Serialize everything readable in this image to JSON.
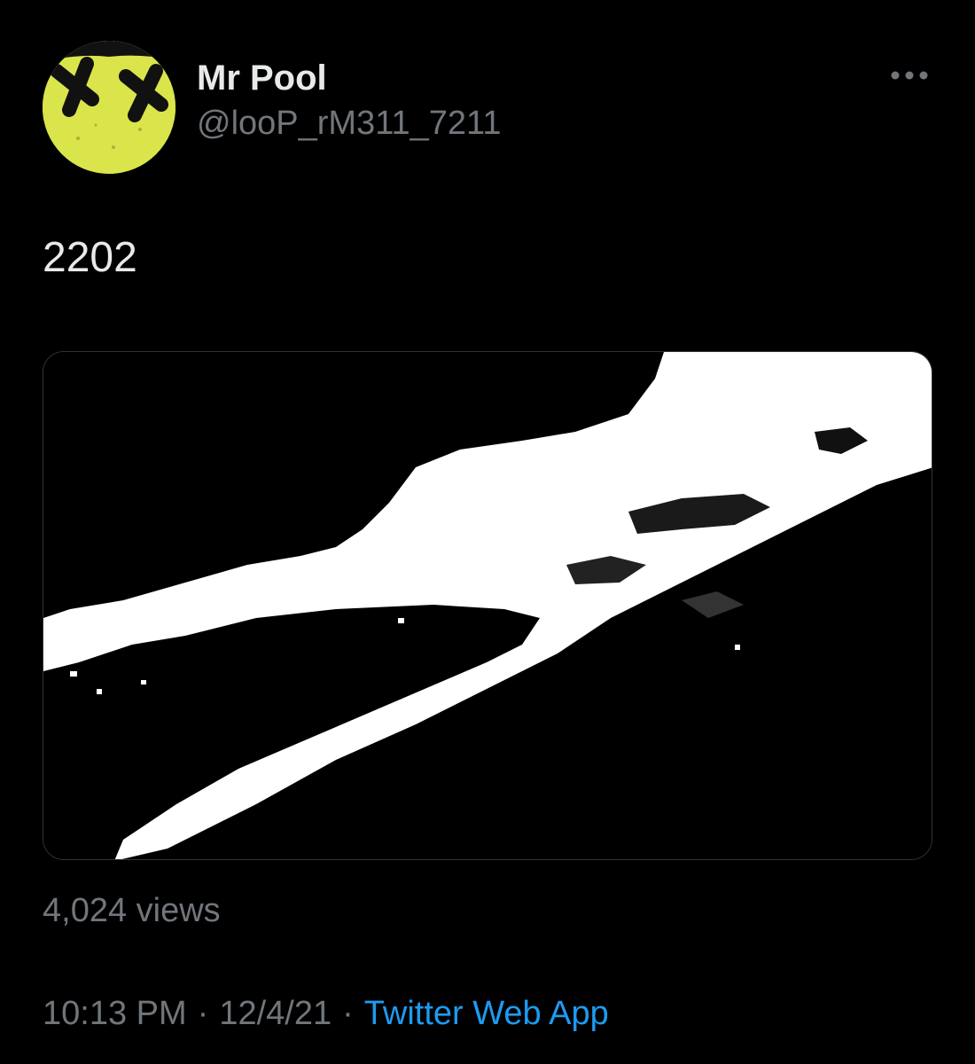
{
  "tweet": {
    "author": {
      "display_name": "Mr Pool",
      "handle": "@looP_rM311_7211",
      "avatar_icon": "yellow-smiley-face-icon",
      "avatar_color": "#d9e54a"
    },
    "more_icon": "more-dots-icon",
    "text": "2202",
    "media": {
      "type": "image",
      "description_icon": "pixelated-white-shape-image"
    },
    "views_label": "4,024 views",
    "time": "10:13 PM",
    "separator": "·",
    "date": "12/4/21",
    "source": "Twitter Web App"
  },
  "colors": {
    "background": "#000000",
    "primary_text": "#e7e9ea",
    "secondary_text": "#71767b",
    "link": "#1d9bf0",
    "border": "#2f3336"
  }
}
